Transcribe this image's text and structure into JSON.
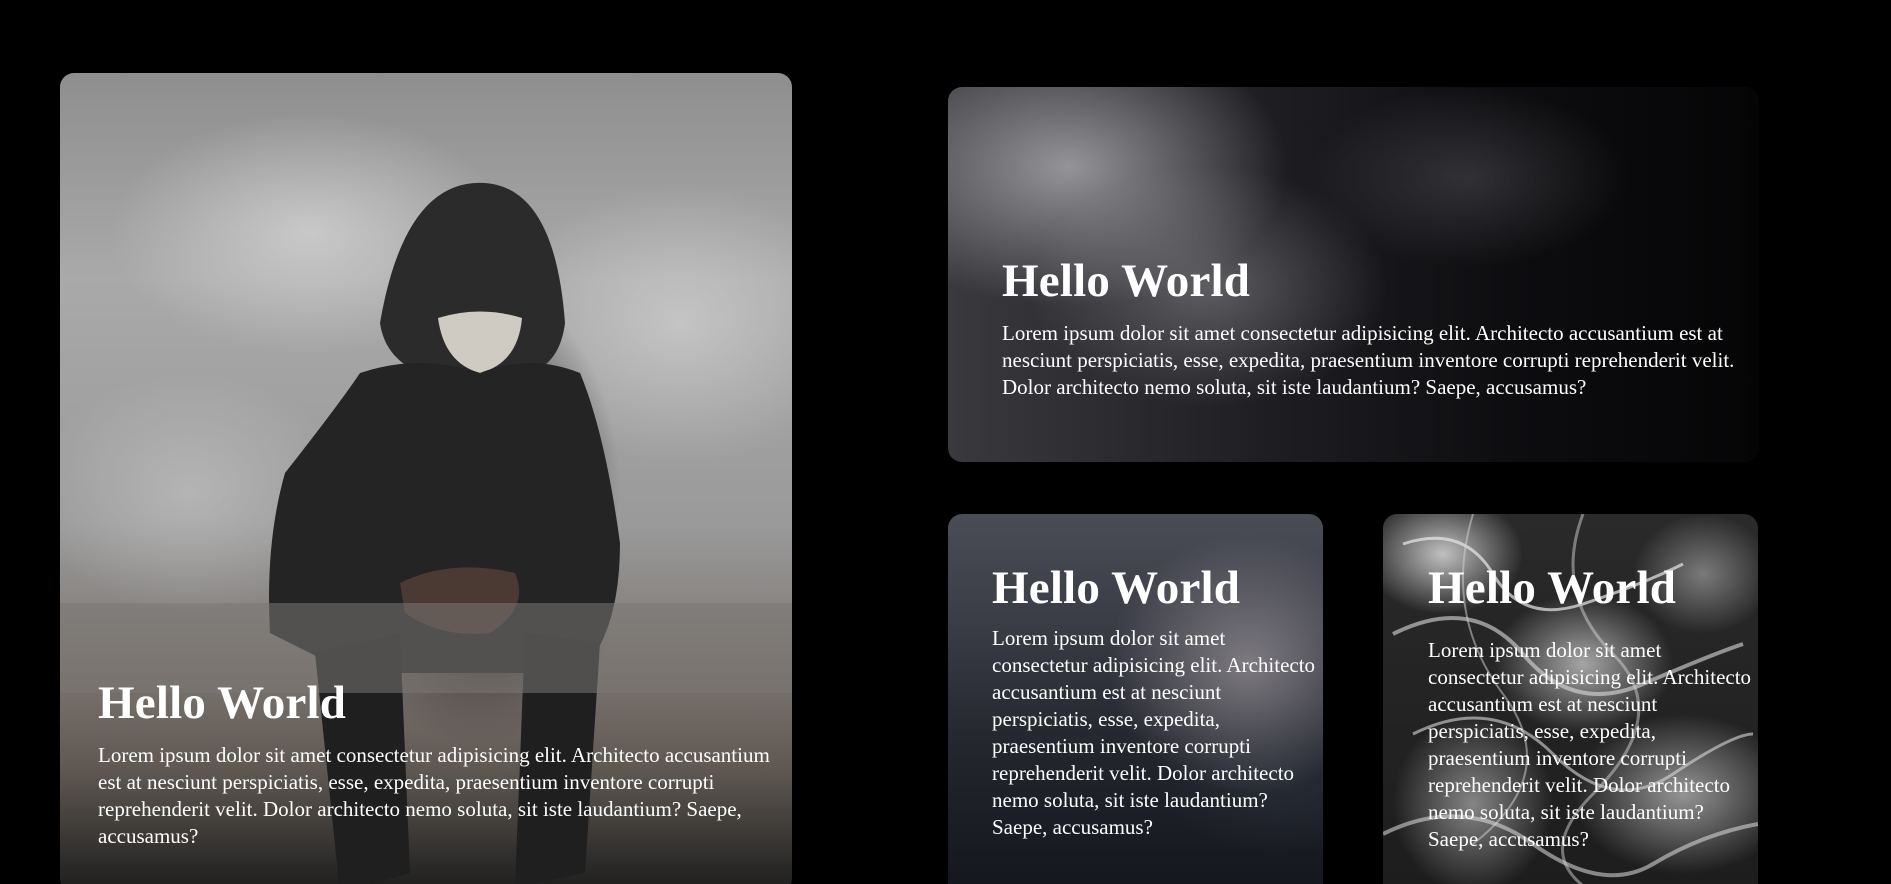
{
  "cards": [
    {
      "title": "Hello World",
      "body": "Lorem ipsum dolor sit amet consectetur adipisicing elit. Architecto accusantium est at nesciunt perspiciatis, esse, expedita, praesentium inventore corrupti reprehenderit velit. Dolor architecto nemo soluta, sit iste laudantium? Saepe, accusamus?"
    },
    {
      "title": "Hello World",
      "body": "Lorem ipsum dolor sit amet consectetur adipisicing elit. Architecto accusantium est at nesciunt perspiciatis, esse, expedita, praesentium inventore corrupti reprehenderit velit. Dolor architecto nemo soluta, sit iste laudantium? Saepe, accusamus?"
    },
    {
      "title": "Hello World",
      "body": "Lorem ipsum dolor sit amet consectetur adipisicing elit. Architecto accusantium est at nesciunt perspiciatis, esse, expedita, praesentium inventore corrupti reprehenderit velit. Dolor architecto nemo soluta, sit iste laudantium? Saepe, accusamus?"
    },
    {
      "title": "Hello World",
      "body": "Lorem ipsum dolor sit amet consectetur adipisicing elit. Architecto accusantium est at nesciunt perspiciatis, esse, expedita, praesentium inventore corrupti reprehenderit velit. Dolor architecto nemo soluta, sit iste laudantium? Saepe, accusamus?"
    }
  ],
  "theme": {
    "background": "#000000",
    "text": "#ffffff"
  }
}
